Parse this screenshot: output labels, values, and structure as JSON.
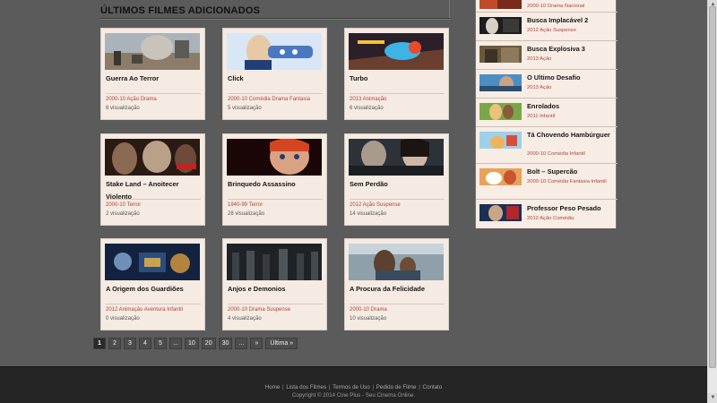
{
  "section": {
    "title": "ÚLTIMOS FILMES ADICIONADOS"
  },
  "cards": [
    {
      "title": "Guerra Ao Terror",
      "meta": "2000-10 Ação Drama",
      "views": "6 visualização",
      "thumb": "desert-war-thumb"
    },
    {
      "title": "Click",
      "meta": "2000-10 Comédia Drama Fantasia",
      "views": "5 visualização",
      "thumb": "remote-control-thumb"
    },
    {
      "title": "Turbo",
      "meta": "2013 Animação",
      "views": "6 visualização",
      "thumb": "snail-race-thumb"
    },
    {
      "title": "Stake Land – Anoitecer Violento",
      "meta": "2000-10 Terror",
      "views": "2 visualização",
      "thumb": "vampires-thumb"
    },
    {
      "title": "Brinquedo Assassino",
      "meta": "1940-99 Terror",
      "views": "28 visualização",
      "thumb": "doll-thumb"
    },
    {
      "title": "Sem Perdão",
      "meta": "2012 Ação Suspense",
      "views": "14 visualização",
      "thumb": "couple-thumb"
    },
    {
      "title": "A Origem dos Guardiões",
      "meta": "2012 Animação Aventura Infantil",
      "views": "0 visualização",
      "thumb": "guardians-thumb"
    },
    {
      "title": "Anjos e Demonios",
      "meta": "2000-10 Drama Suspense",
      "views": "4 visualização",
      "thumb": "crowd-thumb"
    },
    {
      "title": "A Procura da Felicidade",
      "meta": "2000-10 Drama",
      "views": "10 visualização",
      "thumb": "train-thumb"
    }
  ],
  "pagination": {
    "items": [
      "1",
      "2",
      "3",
      "4",
      "5",
      "...",
      "10",
      "20",
      "30",
      "...",
      "»",
      "Última »"
    ],
    "active": "1"
  },
  "sidebar": {
    "items": [
      {
        "title": "",
        "meta": "2000-10 Drama Nacional"
      },
      {
        "title": "Busca Implacável 2",
        "meta": "2012 Ação Suspense"
      },
      {
        "title": "Busca Explosiva 3",
        "meta": "2013 Ação"
      },
      {
        "title": "O Ultimo Desafio",
        "meta": "2013 Ação"
      },
      {
        "title": "Enrolados",
        "meta": "2011 Infantil"
      },
      {
        "title": "Tá Chovendo Hambúrguer",
        "meta": "2000-10 Comédia Infantil"
      },
      {
        "title": "Bolt – Supercão",
        "meta": "2000-10 Comédia Fantasia Infantil"
      },
      {
        "title": "Professor Peso Pesado",
        "meta": "2012 Ação Comédia"
      }
    ]
  },
  "footer": {
    "links": [
      "Home",
      "Lista dos Filmes",
      "Termos de Uso",
      "Pedido de Filme",
      "Contato"
    ],
    "copyright": "Copyright © 2014 Cine Plus - Seu Cinema Online."
  },
  "colors": {
    "accent": "#b0433a",
    "card_bg": "#f5ebe2",
    "page_bg": "#5b5b5b",
    "footer_bg": "#252525"
  }
}
